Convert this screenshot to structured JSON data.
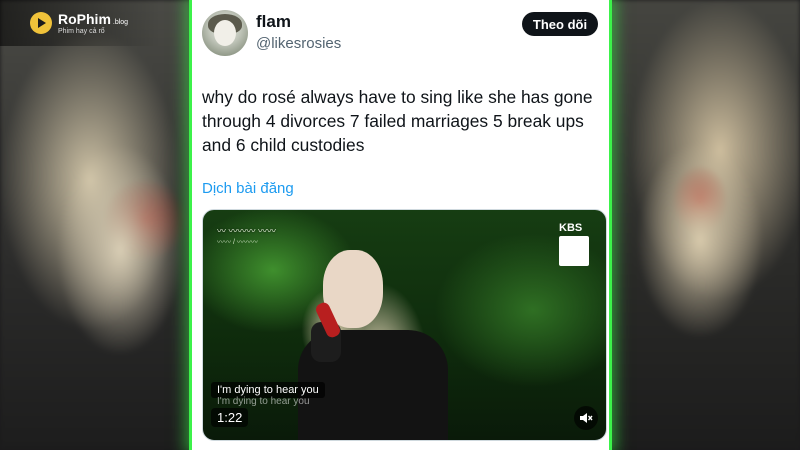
{
  "logo": {
    "name": "RoPhim",
    "tld": ".blog",
    "tagline": "Phim hay cả rổ",
    "accent_color": "#f0c23a"
  },
  "tweet": {
    "display_name": "flam",
    "handle": "@likesrosies",
    "follow_label": "Theo dõi",
    "text": "why do rosé always have to sing like she has gone through 4 divorces 7 failed marriages 5 break ups and 6 child custodies",
    "translate_label": "Dịch bài đăng"
  },
  "video": {
    "broadcaster": "KBS",
    "caption": "I'm dying to hear you",
    "caption_echo": "I'm dying to hear you",
    "duration": "1:22",
    "mute_icon": "speaker-muted-icon"
  },
  "colors": {
    "border_glow": "#3cf24a",
    "link": "#1d9bf0",
    "button_bg": "#0f1419"
  }
}
